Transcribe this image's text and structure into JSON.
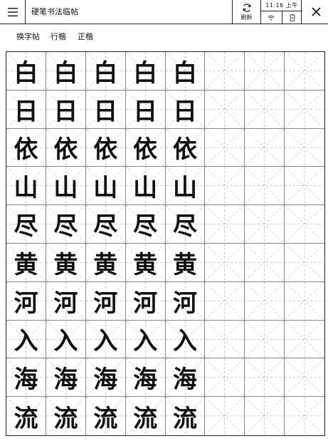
{
  "header": {
    "title": "硬笔书法临帖",
    "refresh_label": "刷新",
    "time": "11:16 上午"
  },
  "toolbar": {
    "items": [
      "换字帖",
      "行楷",
      "正楷"
    ]
  },
  "sheet": {
    "rows": [
      "白",
      "日",
      "依",
      "山",
      "尽",
      "黄",
      "河",
      "入",
      "海",
      "流"
    ],
    "filled_columns": 5,
    "total_columns": 8
  }
}
